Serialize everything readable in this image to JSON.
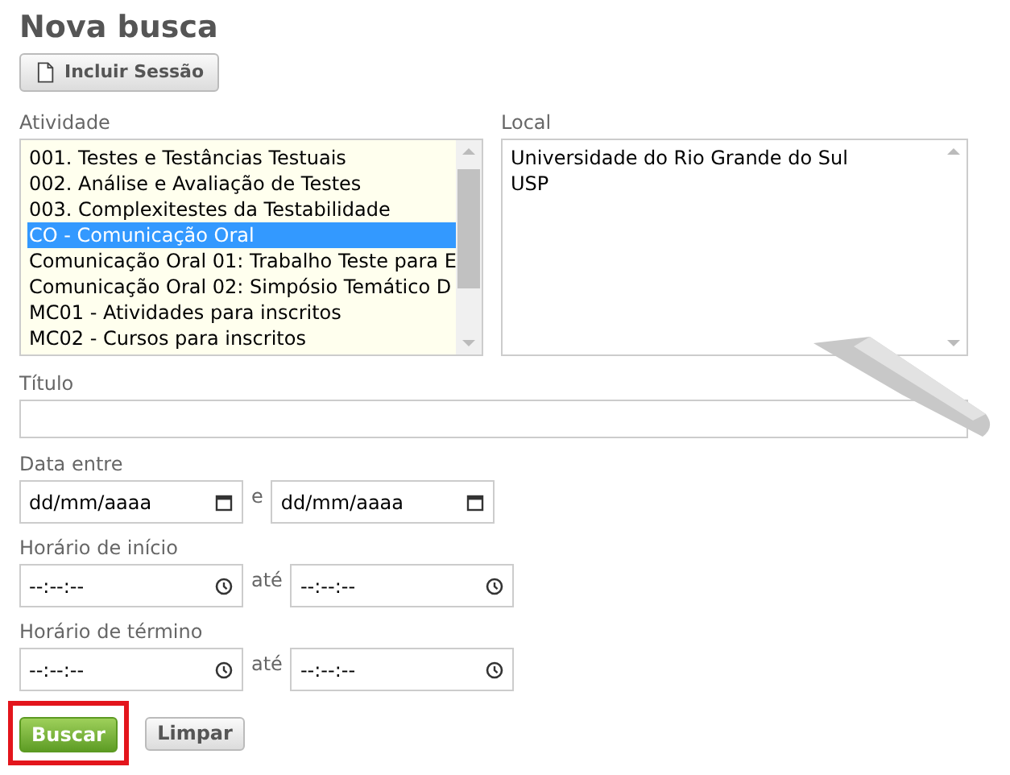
{
  "title": "Nova busca",
  "include_button": {
    "label": "Incluir Sessão"
  },
  "activity": {
    "label": "Atividade",
    "items": [
      {
        "text": "001. Testes e Testâncias Testuais",
        "selected": false
      },
      {
        "text": "002. Análise e Avaliação de Testes",
        "selected": false
      },
      {
        "text": "003. Complexitestes da Testabilidade",
        "selected": false
      },
      {
        "text": "CO - Comunicação Oral",
        "selected": true
      },
      {
        "text": "Comunicação Oral 01: Trabalho Teste para E",
        "selected": false
      },
      {
        "text": "Comunicação Oral 02: Simpósio Temático D",
        "selected": false
      },
      {
        "text": "MC01 - Atividades para inscritos",
        "selected": false
      },
      {
        "text": "MC02 - Cursos para inscritos",
        "selected": false
      }
    ]
  },
  "local": {
    "label": "Local",
    "items": [
      {
        "text": "Universidade do Rio Grande do Sul",
        "selected": false
      },
      {
        "text": "USP",
        "selected": false
      }
    ]
  },
  "title_field": {
    "label": "Título"
  },
  "date_range": {
    "label": "Data entre",
    "from_placeholder": "dd/mm/aaaa",
    "separator": "e",
    "to_placeholder": "dd/mm/aaaa"
  },
  "start_time": {
    "label": "Horário de início",
    "from_placeholder": "--:--:--",
    "separator": "até",
    "to_placeholder": "--:--:--"
  },
  "end_time": {
    "label": "Horário de término",
    "from_placeholder": "--:--:--",
    "separator": "até",
    "to_placeholder": "--:--:--"
  },
  "buttons": {
    "search": "Buscar",
    "clear": "Limpar"
  }
}
